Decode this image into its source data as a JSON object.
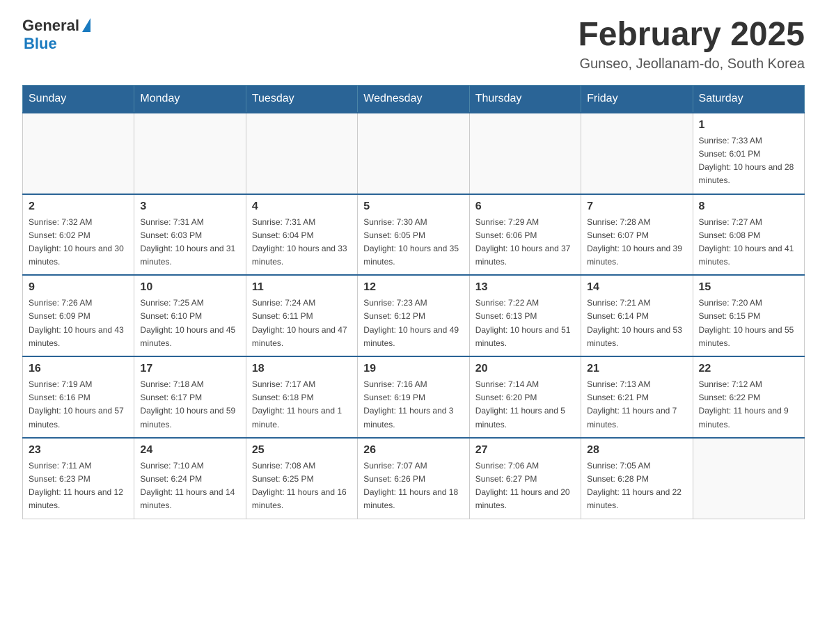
{
  "header": {
    "logo_general": "General",
    "logo_blue": "Blue",
    "title": "February 2025",
    "subtitle": "Gunseo, Jeollanam-do, South Korea"
  },
  "days_of_week": [
    "Sunday",
    "Monday",
    "Tuesday",
    "Wednesday",
    "Thursday",
    "Friday",
    "Saturday"
  ],
  "weeks": [
    [
      {
        "day": "",
        "sunrise": "",
        "sunset": "",
        "daylight": ""
      },
      {
        "day": "",
        "sunrise": "",
        "sunset": "",
        "daylight": ""
      },
      {
        "day": "",
        "sunrise": "",
        "sunset": "",
        "daylight": ""
      },
      {
        "day": "",
        "sunrise": "",
        "sunset": "",
        "daylight": ""
      },
      {
        "day": "",
        "sunrise": "",
        "sunset": "",
        "daylight": ""
      },
      {
        "day": "",
        "sunrise": "",
        "sunset": "",
        "daylight": ""
      },
      {
        "day": "1",
        "sunrise": "Sunrise: 7:33 AM",
        "sunset": "Sunset: 6:01 PM",
        "daylight": "Daylight: 10 hours and 28 minutes."
      }
    ],
    [
      {
        "day": "2",
        "sunrise": "Sunrise: 7:32 AM",
        "sunset": "Sunset: 6:02 PM",
        "daylight": "Daylight: 10 hours and 30 minutes."
      },
      {
        "day": "3",
        "sunrise": "Sunrise: 7:31 AM",
        "sunset": "Sunset: 6:03 PM",
        "daylight": "Daylight: 10 hours and 31 minutes."
      },
      {
        "day": "4",
        "sunrise": "Sunrise: 7:31 AM",
        "sunset": "Sunset: 6:04 PM",
        "daylight": "Daylight: 10 hours and 33 minutes."
      },
      {
        "day": "5",
        "sunrise": "Sunrise: 7:30 AM",
        "sunset": "Sunset: 6:05 PM",
        "daylight": "Daylight: 10 hours and 35 minutes."
      },
      {
        "day": "6",
        "sunrise": "Sunrise: 7:29 AM",
        "sunset": "Sunset: 6:06 PM",
        "daylight": "Daylight: 10 hours and 37 minutes."
      },
      {
        "day": "7",
        "sunrise": "Sunrise: 7:28 AM",
        "sunset": "Sunset: 6:07 PM",
        "daylight": "Daylight: 10 hours and 39 minutes."
      },
      {
        "day": "8",
        "sunrise": "Sunrise: 7:27 AM",
        "sunset": "Sunset: 6:08 PM",
        "daylight": "Daylight: 10 hours and 41 minutes."
      }
    ],
    [
      {
        "day": "9",
        "sunrise": "Sunrise: 7:26 AM",
        "sunset": "Sunset: 6:09 PM",
        "daylight": "Daylight: 10 hours and 43 minutes."
      },
      {
        "day": "10",
        "sunrise": "Sunrise: 7:25 AM",
        "sunset": "Sunset: 6:10 PM",
        "daylight": "Daylight: 10 hours and 45 minutes."
      },
      {
        "day": "11",
        "sunrise": "Sunrise: 7:24 AM",
        "sunset": "Sunset: 6:11 PM",
        "daylight": "Daylight: 10 hours and 47 minutes."
      },
      {
        "day": "12",
        "sunrise": "Sunrise: 7:23 AM",
        "sunset": "Sunset: 6:12 PM",
        "daylight": "Daylight: 10 hours and 49 minutes."
      },
      {
        "day": "13",
        "sunrise": "Sunrise: 7:22 AM",
        "sunset": "Sunset: 6:13 PM",
        "daylight": "Daylight: 10 hours and 51 minutes."
      },
      {
        "day": "14",
        "sunrise": "Sunrise: 7:21 AM",
        "sunset": "Sunset: 6:14 PM",
        "daylight": "Daylight: 10 hours and 53 minutes."
      },
      {
        "day": "15",
        "sunrise": "Sunrise: 7:20 AM",
        "sunset": "Sunset: 6:15 PM",
        "daylight": "Daylight: 10 hours and 55 minutes."
      }
    ],
    [
      {
        "day": "16",
        "sunrise": "Sunrise: 7:19 AM",
        "sunset": "Sunset: 6:16 PM",
        "daylight": "Daylight: 10 hours and 57 minutes."
      },
      {
        "day": "17",
        "sunrise": "Sunrise: 7:18 AM",
        "sunset": "Sunset: 6:17 PM",
        "daylight": "Daylight: 10 hours and 59 minutes."
      },
      {
        "day": "18",
        "sunrise": "Sunrise: 7:17 AM",
        "sunset": "Sunset: 6:18 PM",
        "daylight": "Daylight: 11 hours and 1 minute."
      },
      {
        "day": "19",
        "sunrise": "Sunrise: 7:16 AM",
        "sunset": "Sunset: 6:19 PM",
        "daylight": "Daylight: 11 hours and 3 minutes."
      },
      {
        "day": "20",
        "sunrise": "Sunrise: 7:14 AM",
        "sunset": "Sunset: 6:20 PM",
        "daylight": "Daylight: 11 hours and 5 minutes."
      },
      {
        "day": "21",
        "sunrise": "Sunrise: 7:13 AM",
        "sunset": "Sunset: 6:21 PM",
        "daylight": "Daylight: 11 hours and 7 minutes."
      },
      {
        "day": "22",
        "sunrise": "Sunrise: 7:12 AM",
        "sunset": "Sunset: 6:22 PM",
        "daylight": "Daylight: 11 hours and 9 minutes."
      }
    ],
    [
      {
        "day": "23",
        "sunrise": "Sunrise: 7:11 AM",
        "sunset": "Sunset: 6:23 PM",
        "daylight": "Daylight: 11 hours and 12 minutes."
      },
      {
        "day": "24",
        "sunrise": "Sunrise: 7:10 AM",
        "sunset": "Sunset: 6:24 PM",
        "daylight": "Daylight: 11 hours and 14 minutes."
      },
      {
        "day": "25",
        "sunrise": "Sunrise: 7:08 AM",
        "sunset": "Sunset: 6:25 PM",
        "daylight": "Daylight: 11 hours and 16 minutes."
      },
      {
        "day": "26",
        "sunrise": "Sunrise: 7:07 AM",
        "sunset": "Sunset: 6:26 PM",
        "daylight": "Daylight: 11 hours and 18 minutes."
      },
      {
        "day": "27",
        "sunrise": "Sunrise: 7:06 AM",
        "sunset": "Sunset: 6:27 PM",
        "daylight": "Daylight: 11 hours and 20 minutes."
      },
      {
        "day": "28",
        "sunrise": "Sunrise: 7:05 AM",
        "sunset": "Sunset: 6:28 PM",
        "daylight": "Daylight: 11 hours and 22 minutes."
      },
      {
        "day": "",
        "sunrise": "",
        "sunset": "",
        "daylight": ""
      }
    ]
  ]
}
